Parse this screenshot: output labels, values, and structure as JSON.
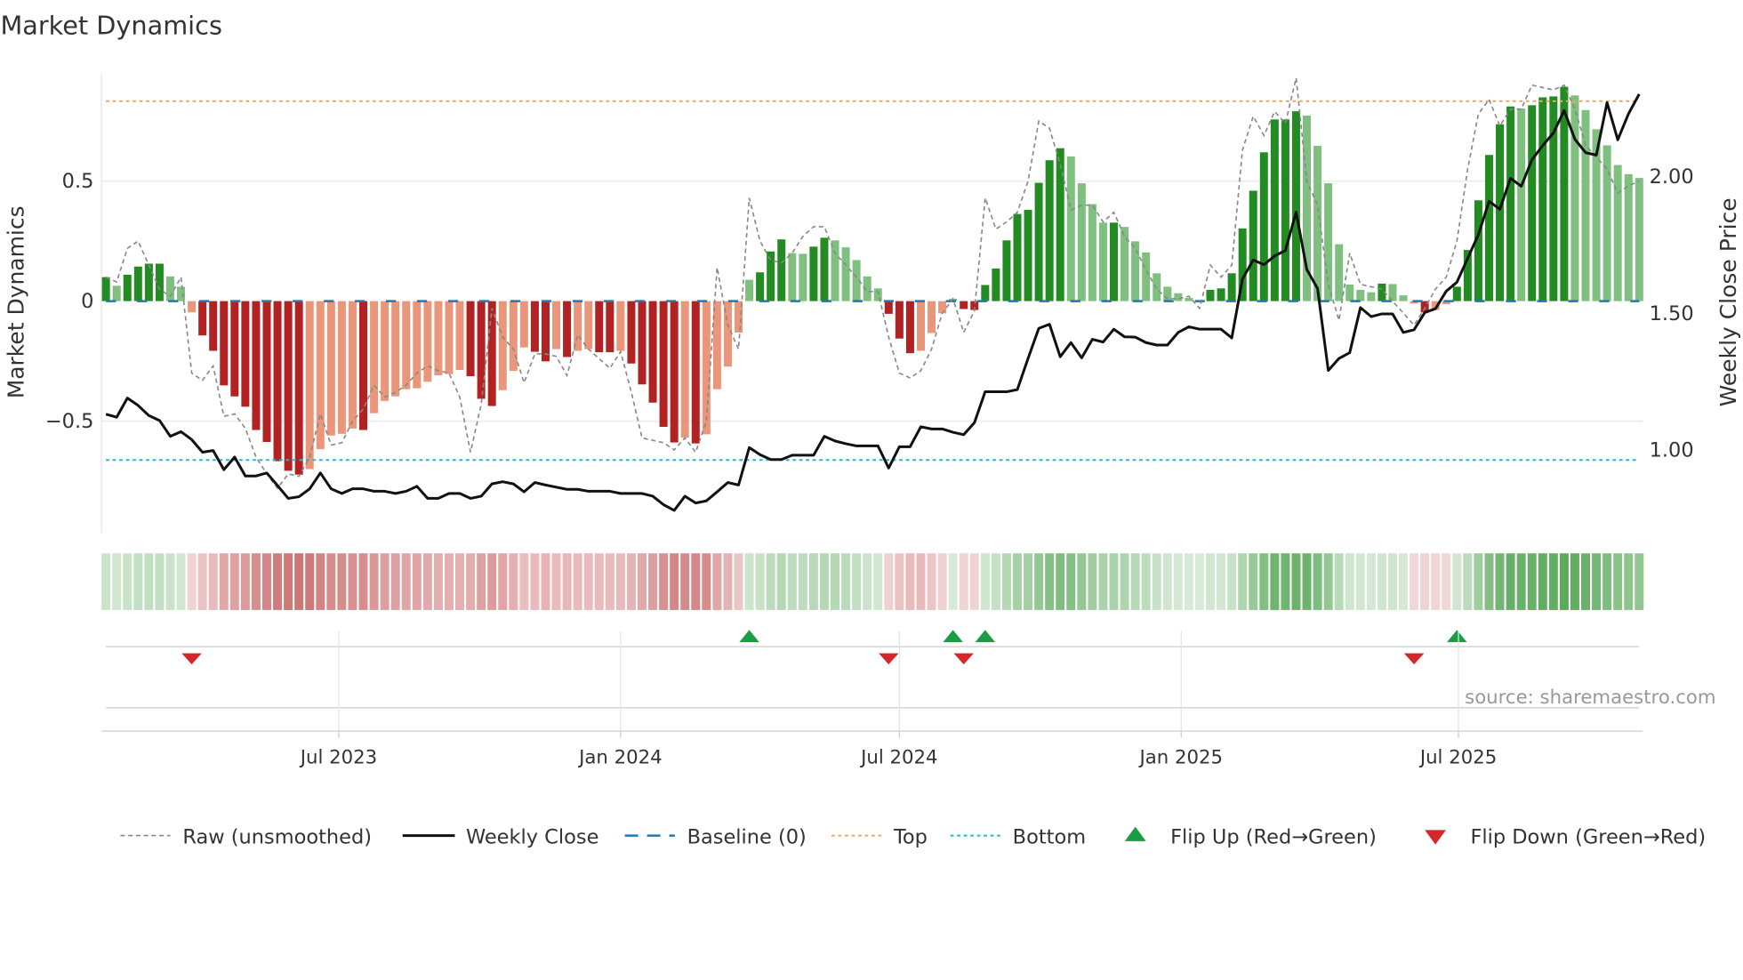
{
  "chart_data": {
    "type": "bar",
    "title": "Market Dynamics",
    "ylabel": "Market Dynamics",
    "y2label": "Weekly Close Price",
    "ylim": [
      -0.97,
      0.96
    ],
    "yticks": [
      {
        "v": 0.5,
        "label": "0.5"
      },
      {
        "v": 0,
        "label": "0"
      },
      {
        "v": -0.5,
        "label": "−0.5"
      }
    ],
    "y2ticks": [
      {
        "v": 2.0,
        "label": "2.00"
      },
      {
        "v": 1.5,
        "label": "1.50"
      },
      {
        "v": 1.0,
        "label": "1.00"
      }
    ],
    "start_week": "2023-01-30",
    "xticks": [
      {
        "date": "2023-07-01",
        "label": "Jul 2023"
      },
      {
        "date": "2024-01-01",
        "label": "Jan 2024"
      },
      {
        "date": "2024-07-01",
        "label": "Jul 2024"
      },
      {
        "date": "2025-01-01",
        "label": "Jan 2025"
      },
      {
        "date": "2025-07-01",
        "label": "Jul 2025"
      }
    ],
    "top_level": 0.833,
    "bottom_level": -0.662,
    "baseline": 0,
    "smoothed": [
      0.1,
      0.064,
      0.11,
      0.144,
      0.156,
      0.156,
      0.103,
      0.06,
      -0.047,
      -0.143,
      -0.207,
      -0.351,
      -0.397,
      -0.44,
      -0.537,
      -0.587,
      -0.667,
      -0.707,
      -0.723,
      -0.7,
      -0.617,
      -0.56,
      -0.553,
      -0.531,
      -0.537,
      -0.467,
      -0.416,
      -0.397,
      -0.367,
      -0.363,
      -0.336,
      -0.309,
      -0.304,
      -0.287,
      -0.313,
      -0.407,
      -0.437,
      -0.371,
      -0.291,
      -0.193,
      -0.211,
      -0.251,
      -0.2,
      -0.233,
      -0.207,
      -0.2,
      -0.213,
      -0.213,
      -0.207,
      -0.26,
      -0.347,
      -0.423,
      -0.524,
      -0.589,
      -0.569,
      -0.593,
      -0.555,
      -0.367,
      -0.273,
      -0.131,
      0.089,
      0.12,
      0.207,
      0.257,
      0.2,
      0.197,
      0.227,
      0.264,
      0.253,
      0.224,
      0.171,
      0.103,
      0.053,
      -0.053,
      -0.156,
      -0.217,
      -0.207,
      -0.133,
      -0.051,
      0.01,
      -0.033,
      -0.037,
      0.067,
      0.136,
      0.253,
      0.363,
      0.38,
      0.493,
      0.587,
      0.637,
      0.603,
      0.491,
      0.404,
      0.327,
      0.327,
      0.309,
      0.249,
      0.203,
      0.116,
      0.06,
      0.033,
      0.013,
      0.003,
      0.047,
      0.053,
      0.116,
      0.303,
      0.46,
      0.62,
      0.757,
      0.757,
      0.791,
      0.773,
      0.647,
      0.491,
      0.237,
      0.069,
      0.047,
      0.037,
      0.073,
      0.071,
      0.024,
      -0.01,
      -0.047,
      -0.037,
      -0.013,
      0.06,
      0.213,
      0.42,
      0.609,
      0.737,
      0.811,
      0.803,
      0.816,
      0.849,
      0.853,
      0.893,
      0.857,
      0.796,
      0.716,
      0.649,
      0.567,
      0.529,
      0.513
    ],
    "raw": [
      0.1,
      0.08,
      0.22,
      0.25,
      0.15,
      0.05,
      0.02,
      0.1,
      -0.3,
      -0.33,
      -0.27,
      -0.48,
      -0.47,
      -0.53,
      -0.65,
      -0.72,
      -0.78,
      -0.72,
      -0.73,
      -0.65,
      -0.47,
      -0.6,
      -0.59,
      -0.5,
      -0.45,
      -0.35,
      -0.4,
      -0.38,
      -0.35,
      -0.3,
      -0.27,
      -0.29,
      -0.3,
      -0.4,
      -0.63,
      -0.43,
      -0.03,
      -0.15,
      -0.2,
      -0.34,
      -0.22,
      -0.22,
      -0.23,
      -0.31,
      -0.14,
      -0.2,
      -0.24,
      -0.28,
      -0.21,
      -0.38,
      -0.57,
      -0.58,
      -0.59,
      -0.62,
      -0.57,
      -0.63,
      -0.5,
      0.14,
      -0.1,
      -0.2,
      0.43,
      0.25,
      0.17,
      0.16,
      0.2,
      0.27,
      0.31,
      0.31,
      0.2,
      0.15,
      0.1,
      0.04,
      0.04,
      -0.15,
      -0.3,
      -0.32,
      -0.29,
      -0.2,
      -0.05,
      0.01,
      -0.13,
      -0.04,
      0.43,
      0.3,
      0.33,
      0.37,
      0.5,
      0.75,
      0.72,
      0.57,
      0.38,
      0.4,
      0.4,
      0.33,
      0.37,
      0.27,
      0.22,
      0.13,
      0.05,
      0.01,
      0.01,
      0.02,
      -0.03,
      0.15,
      0.1,
      0.15,
      0.63,
      0.77,
      0.69,
      0.79,
      0.74,
      0.93,
      0.5,
      0.4,
      0.07,
      -0.08,
      0.2,
      0.07,
      0.06,
      0.05,
      0.0,
      -0.05,
      -0.1,
      -0.03,
      0.05,
      0.1,
      0.25,
      0.55,
      0.78,
      0.84,
      0.73,
      0.8,
      0.8,
      0.9,
      0.89,
      0.88,
      0.9,
      0.8,
      0.65,
      0.6,
      0.55,
      0.45,
      0.48,
      0.5
    ],
    "price": [
      1.131,
      1.12,
      1.19,
      1.163,
      1.126,
      1.108,
      1.05,
      1.067,
      1.038,
      0.992,
      0.998,
      0.928,
      0.974,
      0.905,
      0.905,
      0.916,
      0.87,
      0.823,
      0.829,
      0.858,
      0.916,
      0.858,
      0.841,
      0.858,
      0.858,
      0.849,
      0.849,
      0.841,
      0.849,
      0.867,
      0.823,
      0.823,
      0.841,
      0.841,
      0.823,
      0.831,
      0.876,
      0.884,
      0.876,
      0.847,
      0.881,
      0.872,
      0.864,
      0.856,
      0.856,
      0.849,
      0.849,
      0.849,
      0.841,
      0.841,
      0.841,
      0.831,
      0.8,
      0.779,
      0.831,
      0.806,
      0.814,
      0.847,
      0.881,
      0.872,
      1.009,
      0.983,
      0.965,
      0.965,
      0.981,
      0.981,
      0.981,
      1.05,
      1.033,
      1.023,
      1.015,
      1.015,
      1.015,
      0.934,
      1.012,
      1.012,
      1.085,
      1.077,
      1.077,
      1.065,
      1.056,
      1.1,
      1.213,
      1.213,
      1.213,
      1.221,
      1.335,
      1.445,
      1.46,
      1.341,
      1.393,
      1.337,
      1.405,
      1.395,
      1.442,
      1.414,
      1.413,
      1.393,
      1.384,
      1.384,
      1.43,
      1.451,
      1.442,
      1.442,
      1.442,
      1.41,
      1.626,
      1.695,
      1.678,
      1.71,
      1.73,
      1.87,
      1.66,
      1.591,
      1.291,
      1.335,
      1.356,
      1.521,
      1.488,
      1.498,
      1.498,
      1.43,
      1.44,
      1.503,
      1.517,
      1.581,
      1.614,
      1.701,
      1.788,
      1.91,
      1.881,
      1.994,
      1.965,
      2.062,
      2.114,
      2.16,
      2.242,
      2.137,
      2.088,
      2.079,
      2.271,
      2.135,
      2.23,
      2.302
    ],
    "flip_up_weeks": [
      60,
      79,
      82,
      126
    ],
    "flip_down_weeks": [
      8,
      73,
      80,
      122
    ],
    "colors": {
      "green_dark": "#228b22",
      "green_light": "#7fbf7f",
      "red_dark": "#b22222",
      "red_light": "#e9967a",
      "top": "#f4a460",
      "bottom": "#17becf",
      "baseline": "#1f77b4",
      "flip_up": "#1a9e45",
      "flip_down": "#d62728"
    },
    "legend": [
      {
        "key": "raw",
        "label": "Raw (unsmoothed)"
      },
      {
        "key": "close",
        "label": "Weekly Close"
      },
      {
        "key": "baseline",
        "label": "Baseline (0)"
      },
      {
        "key": "top",
        "label": "Top"
      },
      {
        "key": "bottom",
        "label": "Bottom"
      },
      {
        "key": "up",
        "label": "Flip Up (Red→Green)"
      },
      {
        "key": "down",
        "label": "Flip Down (Green→Red)"
      }
    ],
    "source": "source: sharemaestro.com"
  }
}
